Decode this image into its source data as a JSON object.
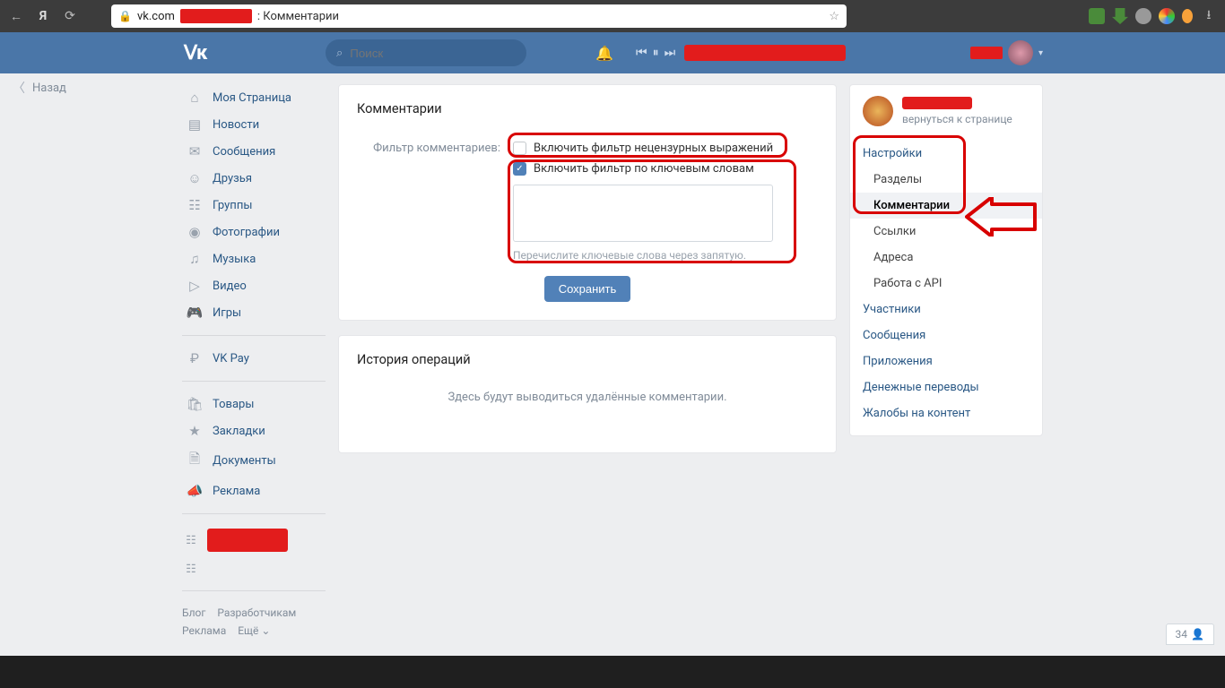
{
  "browser": {
    "domain": "vk.com",
    "title_suffix": ": Комментарии"
  },
  "vk": {
    "search_placeholder": "Поиск",
    "back_label": "Назад"
  },
  "left_nav": {
    "items": [
      {
        "icon": "⌂",
        "label": "Моя Страница"
      },
      {
        "icon": "▤",
        "label": "Новости"
      },
      {
        "icon": "✉",
        "label": "Сообщения"
      },
      {
        "icon": "☺",
        "label": "Друзья"
      },
      {
        "icon": "☷",
        "label": "Группы"
      },
      {
        "icon": "◉",
        "label": "Фотографии"
      },
      {
        "icon": "♫",
        "label": "Музыка"
      },
      {
        "icon": "▷",
        "label": "Видео"
      },
      {
        "icon": "🎮",
        "label": "Игры"
      }
    ],
    "pay_label": "VK Pay",
    "items2": [
      {
        "icon": "🛍",
        "label": "Товары"
      },
      {
        "icon": "★",
        "label": "Закладки"
      },
      {
        "icon": "🗎",
        "label": "Документы"
      },
      {
        "icon": "📣",
        "label": "Реклама"
      }
    ],
    "footer": {
      "blog": "Блог",
      "dev": "Разработчикам",
      "ads": "Реклама",
      "more": "Ещё ⌄"
    }
  },
  "main": {
    "card_title": "Комментарии",
    "filter_label": "Фильтр комментариев:",
    "cb_profanity": "Включить фильтр нецензурных выражений",
    "cb_keywords": "Включить фильтр по ключевым словам",
    "kw_hint": "Перечислите ключевые слова через запятую.",
    "save_label": "Сохранить",
    "history_title": "История операций",
    "history_empty": "Здесь будут выводиться удалённые комментарии."
  },
  "right": {
    "back_to_page": "вернуться к странице",
    "settings": "Настройки",
    "sections": "Разделы",
    "comments": "Комментарии",
    "links": "Ссылки",
    "addresses": "Адреса",
    "api": "Работа с API",
    "members": "Участники",
    "messages": "Сообщения",
    "apps": "Приложения",
    "money": "Денежные переводы",
    "complaints": "Жалобы на контент"
  },
  "counter": "34"
}
